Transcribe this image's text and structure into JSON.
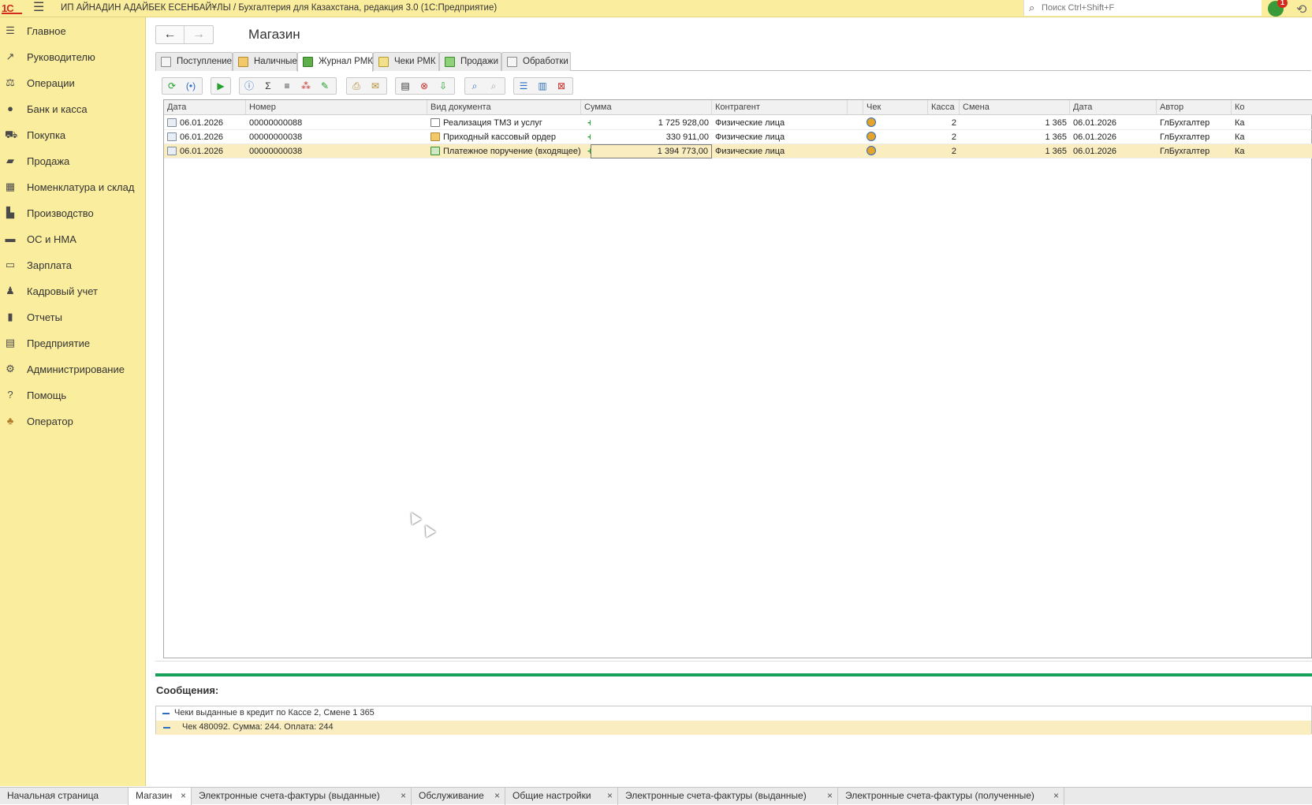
{
  "titlebar": {
    "logo": "1С",
    "app_title": "ИП АЙНАДИН АДАЙБЕК ЕСЕНБАЙҰЛЫ / Бухгалтерия для Казахстана, редакция 3.0  (1С:Предприятие)",
    "search_placeholder": "Поиск Ctrl+Shift+F",
    "notifications_count": "1"
  },
  "sidebar": {
    "items": [
      {
        "label": "Главное",
        "icon": "menu-icon"
      },
      {
        "label": "Руководителю",
        "icon": "trend-icon"
      },
      {
        "label": "Операции",
        "icon": "balance-icon"
      },
      {
        "label": "Банк и касса",
        "icon": "bank-icon"
      },
      {
        "label": "Покупка",
        "icon": "cart-icon"
      },
      {
        "label": "Продажа",
        "icon": "bag-icon"
      },
      {
        "label": "Номенклатура и склад",
        "icon": "grid-icon"
      },
      {
        "label": "Производство",
        "icon": "factory-icon"
      },
      {
        "label": "ОС и НМА",
        "icon": "truck-icon"
      },
      {
        "label": "Зарплата",
        "icon": "wallet-icon"
      },
      {
        "label": "Кадровый учет",
        "icon": "people-icon"
      },
      {
        "label": "Отчеты",
        "icon": "chart-icon"
      },
      {
        "label": "Предприятие",
        "icon": "building-icon"
      },
      {
        "label": "Администрирование",
        "icon": "gear-icon"
      },
      {
        "label": "Помощь",
        "icon": "help-icon"
      },
      {
        "label": "Оператор",
        "icon": "operator-icon"
      }
    ]
  },
  "page": {
    "title": "Магазин",
    "tabs": [
      {
        "label": "Поступление",
        "icon": "document-icon"
      },
      {
        "label": "Наличные",
        "icon": "cash-icon"
      },
      {
        "label": "Журнал РМК",
        "icon": "journal-icon"
      },
      {
        "label": "Чеки РМК",
        "icon": "receipt-icon"
      },
      {
        "label": "Продажи",
        "icon": "sales-icon"
      },
      {
        "label": "Обработки",
        "icon": "processing-icon"
      }
    ],
    "active_tab": "Журнал РМК"
  },
  "table": {
    "columns": [
      "Дата",
      "Номер",
      "Вид документа",
      "Сумма",
      "Контрагент",
      "",
      "Чек",
      "Касса",
      "Смена",
      "Дата",
      "Автор",
      "Ко"
    ],
    "rows": [
      {
        "date": "06.01.2026",
        "number": "00000000088",
        "doc_type": "Реализация ТМЗ и услуг",
        "sum": "1 725 928,00",
        "counterparty": "Физические лица",
        "kassa": "2",
        "smena": "1 365",
        "date2": "06.01.2026",
        "author": "ГлБухгалтер",
        "extra": "Ка"
      },
      {
        "date": "06.01.2026",
        "number": "00000000038",
        "doc_type": "Приходный кассовый ордер",
        "sum": "330 911,00",
        "counterparty": "Физические лица",
        "kassa": "2",
        "smena": "1 365",
        "date2": "06.01.2026",
        "author": "ГлБухгалтер",
        "extra": "Ка"
      },
      {
        "date": "06.01.2026",
        "number": "00000000038",
        "doc_type": "Платежное поручение (входящее)",
        "sum": "1 394 773,00",
        "counterparty": "Физические лица",
        "kassa": "2",
        "smena": "1 365",
        "date2": "06.01.2026",
        "author": "ГлБухгалтер",
        "extra": "Ка"
      }
    ]
  },
  "messages": {
    "title": "Сообщения:",
    "items": [
      "Чеки выданные в кредит по Кассе 2, Смене 1 365",
      "Чек 480092. Сумма: 244. Оплата: 244"
    ]
  },
  "taskbar": {
    "tabs": [
      {
        "label": "Начальная страница",
        "closable": false
      },
      {
        "label": "Магазин",
        "closable": true
      },
      {
        "label": "Электронные счета-фактуры (выданные)",
        "closable": true
      },
      {
        "label": "Обслуживание",
        "closable": true
      },
      {
        "label": "Общие настройки",
        "closable": true
      },
      {
        "label": "Электронные счета-фактуры (выданные)",
        "closable": true
      },
      {
        "label": "Электронные счета-фактуры (полученные)",
        "closable": true
      }
    ],
    "close_glyph": "×"
  },
  "colors": {
    "sidebar_bg": "#fbed9e",
    "accent_green": "#16a05a",
    "selection": "#faeec0"
  }
}
